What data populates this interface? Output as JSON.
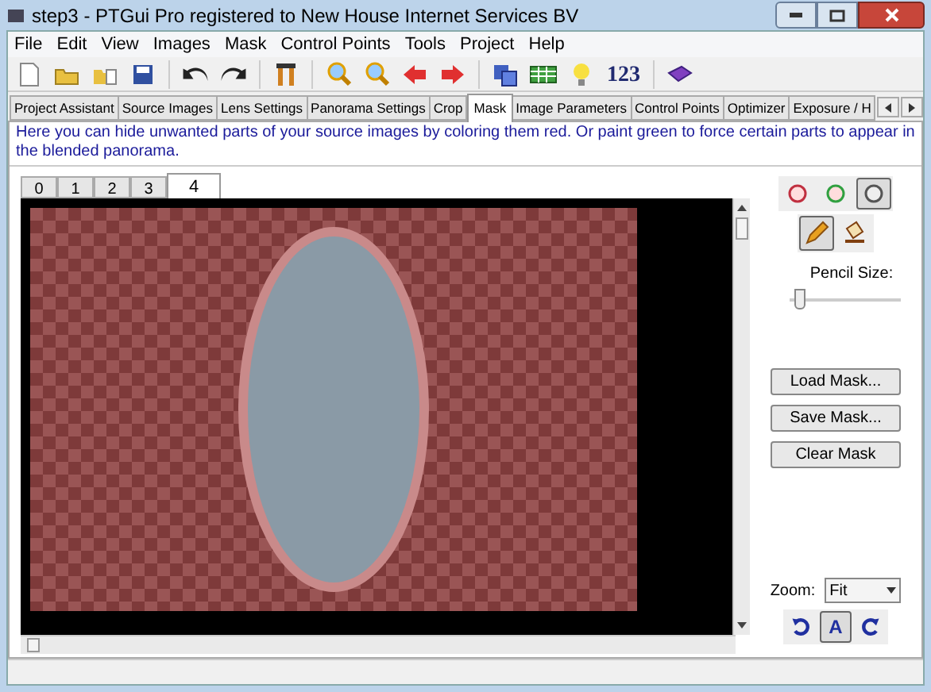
{
  "window": {
    "title": "step3 - PTGui Pro registered to New House Internet Services BV"
  },
  "menu": [
    "File",
    "Edit",
    "View",
    "Images",
    "Mask",
    "Control Points",
    "Tools",
    "Project",
    "Help"
  ],
  "toolbar": {
    "number_button": "123"
  },
  "tabs": [
    {
      "label": "Project Assistant",
      "selected": false
    },
    {
      "label": "Source Images",
      "selected": false
    },
    {
      "label": "Lens Settings",
      "selected": false
    },
    {
      "label": "Panorama Settings",
      "selected": false
    },
    {
      "label": "Crop",
      "selected": false
    },
    {
      "label": "Mask",
      "selected": true
    },
    {
      "label": "Image Parameters",
      "selected": false
    },
    {
      "label": "Control Points",
      "selected": false
    },
    {
      "label": "Optimizer",
      "selected": false
    },
    {
      "label": "Exposure / H",
      "selected": false
    }
  ],
  "hint": "Here you can hide unwanted parts of your source images by coloring them red. Or paint green to force certain parts to appear in the blended panorama.",
  "image_tabs": [
    {
      "label": "0",
      "selected": false
    },
    {
      "label": "1",
      "selected": false
    },
    {
      "label": "2",
      "selected": false
    },
    {
      "label": "3",
      "selected": false
    },
    {
      "label": "4",
      "selected": true
    }
  ],
  "mask_colors": [
    {
      "kind": "red",
      "selected": false
    },
    {
      "kind": "green",
      "selected": false
    },
    {
      "kind": "clear",
      "selected": true
    }
  ],
  "tools": [
    {
      "kind": "pencil",
      "selected": true
    },
    {
      "kind": "fill",
      "selected": false
    }
  ],
  "pencil_size": {
    "label": "Pencil Size:",
    "level": 0.05
  },
  "buttons": [
    "Load Mask...",
    "Save Mask...",
    "Clear Mask"
  ],
  "zoom": {
    "label": "Zoom:",
    "value": "Fit"
  },
  "view_buttons": [
    {
      "kind": "rotate_left",
      "selected": false
    },
    {
      "kind": "auto",
      "text": "A",
      "selected": true
    },
    {
      "kind": "rotate_right",
      "selected": false
    }
  ]
}
